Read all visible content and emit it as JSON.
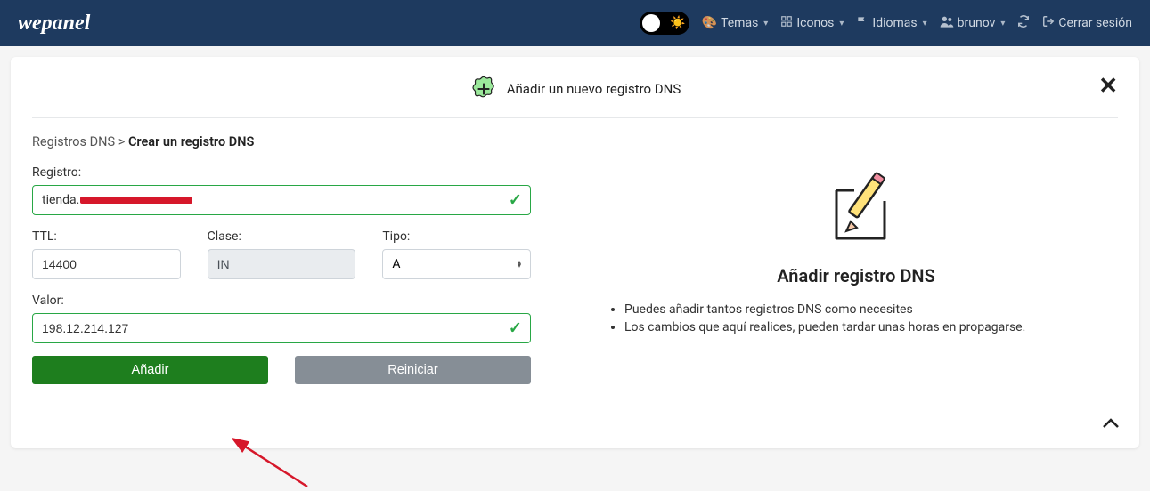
{
  "topbar": {
    "logo": "wepanel",
    "themes": "Temas",
    "icons": "Iconos",
    "languages": "Idiomas",
    "user": "brunov",
    "logout": "Cerrar sesión"
  },
  "header": {
    "title": "Añadir un nuevo registro DNS"
  },
  "breadcrumb": {
    "root": "Registros DNS",
    "sep": ">",
    "current": "Crear un registro DNS"
  },
  "form": {
    "registro_label": "Registro:",
    "registro_value_prefix": "tienda.",
    "ttl_label": "TTL:",
    "ttl_value": "14400",
    "clase_label": "Clase:",
    "clase_value": "IN",
    "tipo_label": "Tipo:",
    "tipo_value": "A",
    "valor_label": "Valor:",
    "valor_value": "198.12.214.127",
    "add_btn": "Añadir",
    "reset_btn": "Reiniciar"
  },
  "right": {
    "title": "Añadir registro DNS",
    "bullets": [
      "Puedes añadir tantos registros DNS como necesites",
      "Los cambios que aquí realices, pueden tardar unas horas en propagarse."
    ]
  }
}
